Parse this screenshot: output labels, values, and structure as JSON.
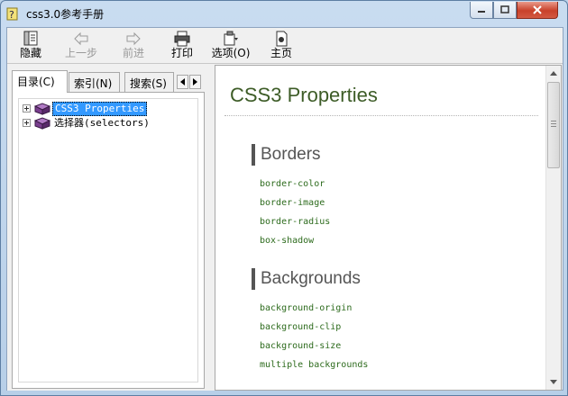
{
  "window": {
    "title": "css3.0参考手册"
  },
  "toolbar": {
    "buttons": [
      {
        "label": "隐藏",
        "icon": "hide-icon",
        "enabled": true
      },
      {
        "label": "上一步",
        "icon": "back-arrow-icon",
        "enabled": false
      },
      {
        "label": "前进",
        "icon": "forward-arrow-icon",
        "enabled": false
      },
      {
        "label": "打印",
        "icon": "printer-icon",
        "enabled": true
      },
      {
        "label": "选项(O)",
        "icon": "options-icon",
        "enabled": true
      },
      {
        "label": "主页",
        "icon": "home-icon",
        "enabled": true
      }
    ]
  },
  "nav_tabs": [
    {
      "label": "目录(C)",
      "active": true
    },
    {
      "label": "索引(N)",
      "active": false
    },
    {
      "label": "搜索(S)",
      "active": false
    }
  ],
  "tree": {
    "items": [
      {
        "label": "CSS3 Properties",
        "selected": true
      },
      {
        "label": "选择器(selectors)",
        "selected": false
      }
    ]
  },
  "content": {
    "title": "CSS3 Properties",
    "sections": [
      {
        "heading": "Borders",
        "links": [
          "border-color",
          "border-image",
          "border-radius",
          "box-shadow"
        ]
      },
      {
        "heading": "Backgrounds",
        "links": [
          "background-origin",
          "background-clip",
          "background-size",
          "multiple backgrounds"
        ]
      }
    ]
  },
  "colors": {
    "heading_green": "#3d5c27",
    "link_green": "#2d6b1d",
    "selection_blue": "#3399ff",
    "book_purple": "#7a3e8f"
  }
}
